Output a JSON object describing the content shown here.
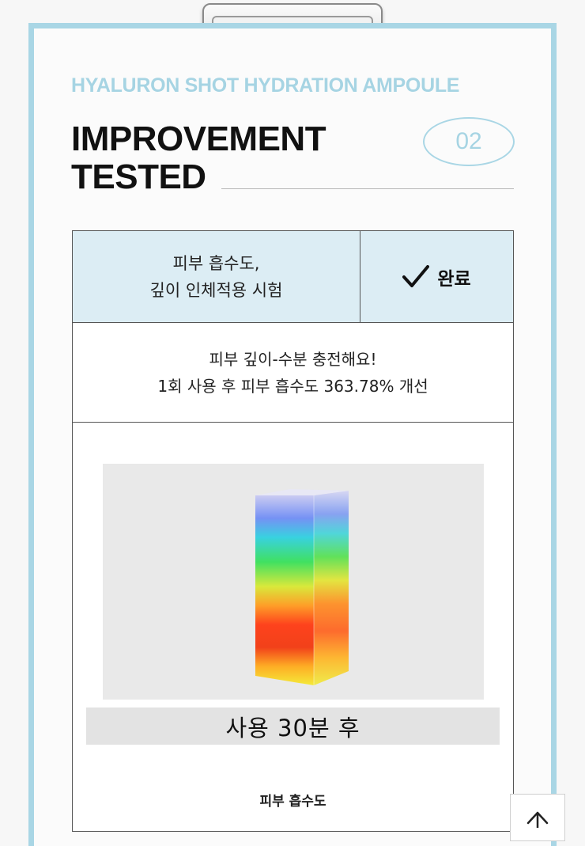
{
  "header": {
    "subtitle": "HYALURON SHOT HYDRATION AMPOULE",
    "title_line1": "IMPROVEMENT",
    "title_line2": "TESTED",
    "badge_number": "02"
  },
  "test_table": {
    "head_left_line1": "피부 흡수도,",
    "head_left_line2": "깊이 인체적용 시험",
    "status_label": "완료",
    "status_icon": "check-icon",
    "desc_line1": "피부 깊이-수분 충전해요!",
    "desc_line2": "1회 사용 후 피부 흡수도 363.78% 개선",
    "figure_caption": "사용 30분 후",
    "section_label": "피부 흡수도"
  },
  "colors": {
    "accent_blue": "#a9d6e5",
    "head_bg": "#dcedf4"
  },
  "controls": {
    "scroll_top_icon": "arrow-up-icon"
  }
}
